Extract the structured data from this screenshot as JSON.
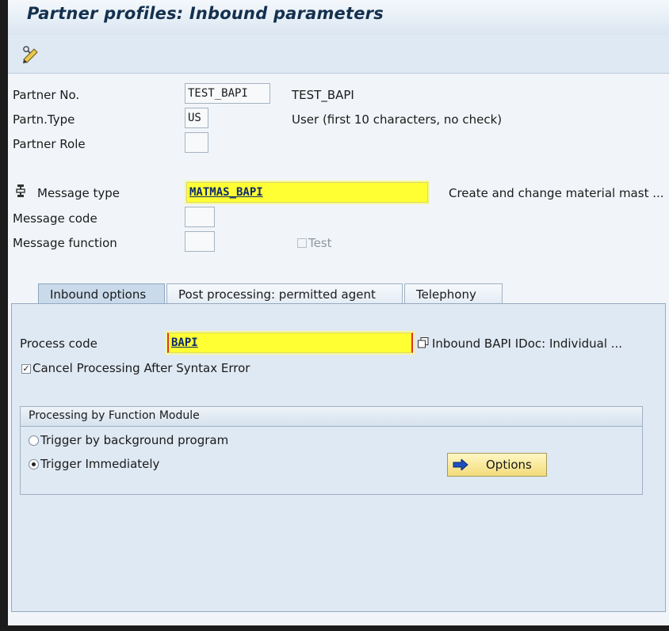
{
  "window": {
    "title": "Partner profiles: Inbound parameters"
  },
  "toolbar": {
    "icon": "display-change-icon"
  },
  "partner": {
    "number_label": "Partner No.",
    "number_value": "TEST_BAPI",
    "number_desc": "TEST_BAPI",
    "type_label": "Partn.Type",
    "type_value": "US",
    "type_desc": "User (first 10 characters, no check)",
    "role_label": "Partner Role",
    "role_value": ""
  },
  "message": {
    "type_label": "Message type",
    "type_value": "MATMAS_BAPI",
    "type_desc": "Create and change material mast ...",
    "code_label": "Message code",
    "code_value": "",
    "function_label": "Message function",
    "function_value": "",
    "test_label": "Test",
    "test_checked": false
  },
  "tabs": [
    {
      "label": "Inbound options",
      "active": true
    },
    {
      "label": "Post processing: permitted agent",
      "active": false
    },
    {
      "label": "Telephony",
      "active": false
    }
  ],
  "inbound": {
    "process_code_label": "Process code",
    "process_code_value": "BAPI",
    "process_code_desc": "Inbound BAPI IDoc: Individual ...",
    "cancel_label": "Cancel Processing After Syntax Error",
    "cancel_checked": true
  },
  "processing": {
    "group_title": "Processing by Function Module",
    "option_background": "Trigger by background program",
    "option_immediately": "Trigger Immediately",
    "selected": "immediately",
    "options_button": "Options"
  },
  "colors": {
    "highlight": "#ffff33",
    "title_text": "#14304e",
    "panel": "#dfe9f3"
  }
}
